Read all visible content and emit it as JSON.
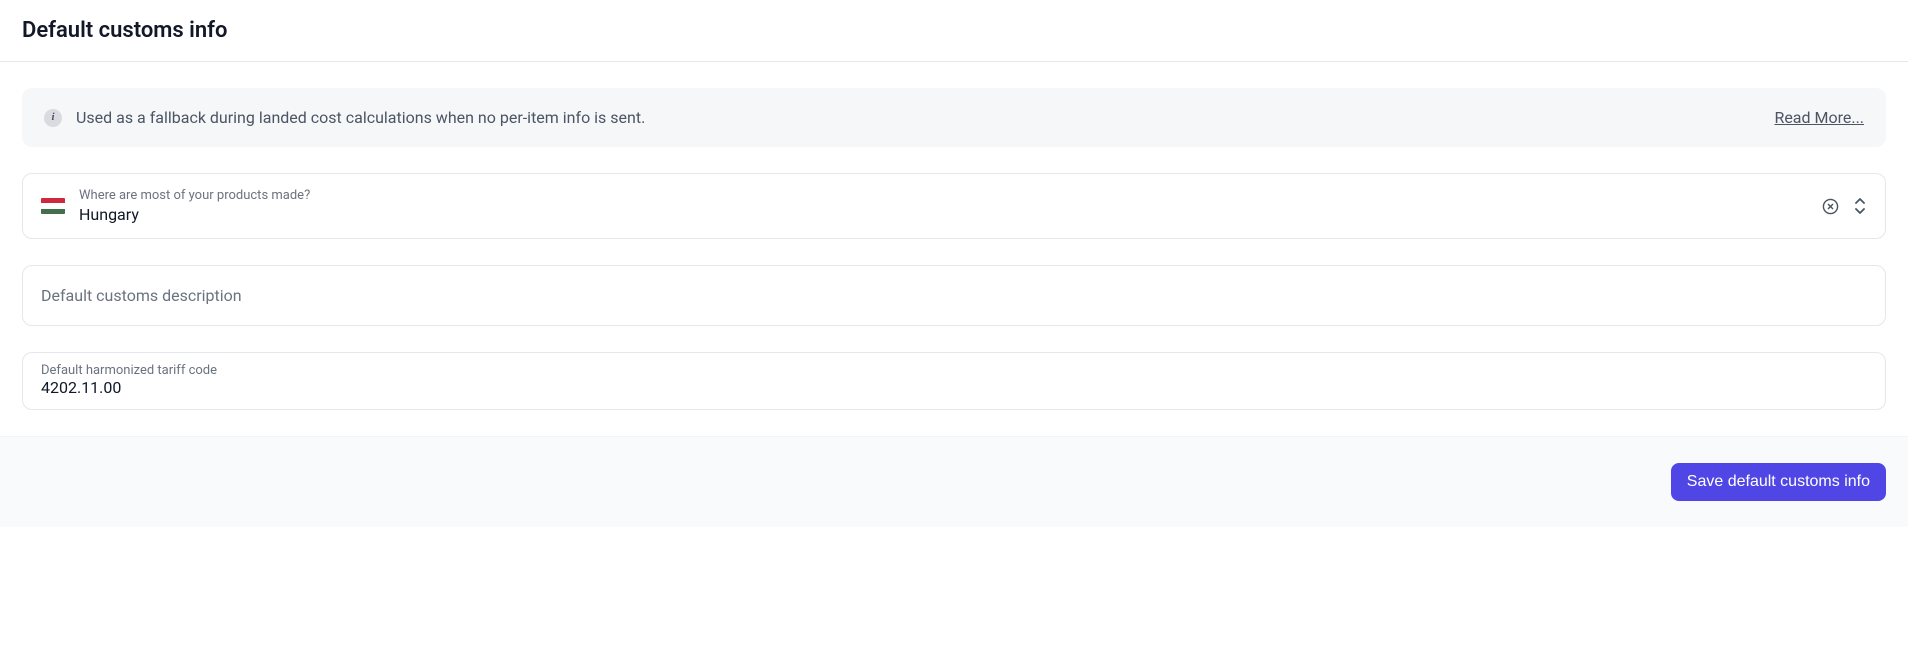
{
  "header": {
    "title": "Default customs info"
  },
  "info": {
    "message": "Used as a fallback during landed cost calculations when no per-item info is sent.",
    "read_more": "Read More..."
  },
  "country_field": {
    "label": "Where are most of your products made?",
    "value": "Hungary"
  },
  "description_field": {
    "placeholder": "Default customs description"
  },
  "tariff_field": {
    "label": "Default harmonized tariff code",
    "value": "4202.11.00"
  },
  "footer": {
    "save_label": "Save default customs info"
  }
}
